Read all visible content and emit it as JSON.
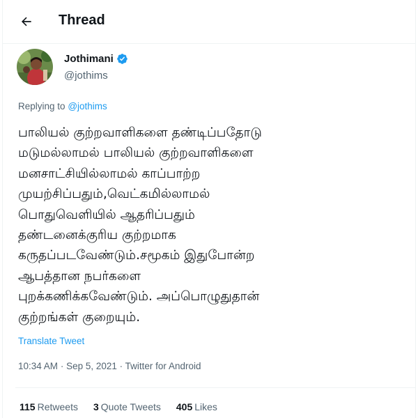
{
  "colors": {
    "accent": "#1d9bf0",
    "secondary_text": "#536471",
    "primary_text": "#0f1419",
    "divider": "#eff3f4"
  },
  "header": {
    "back_icon": "arrow-left-icon",
    "title": "Thread"
  },
  "author": {
    "name": "Jothimani",
    "handle": "@jothims",
    "verified_icon": "verified-badge-icon"
  },
  "tweet": {
    "replying_to_label": "Replying to",
    "replying_to_handle": "@jothims",
    "lines": [
      "பாலியல் குற்றவாளிகளை தண்டிப்பதோடு",
      "மடுமல்லாமல் பாலியல் குற்றவாளிகளை",
      "மனசாட்சியில்லாமல் காப்பாற்ற",
      "முயற்சிப்பதும்,வெட்கமில்லாமல்",
      "பொதுவெளியில் ஆதரிப்பதும்",
      "தண்டனைக்குரிய குற்றமாக",
      "கருதப்படவேண்டும்.சமூகம் இதுபோன்ற",
      "ஆபத்தான நபர்களை",
      "புறக்கணிக்கவேண்டும். அப்பொழுதுதான்",
      "குற்றங்கள் குறையும்."
    ],
    "translate_label": "Translate Tweet",
    "time": "10:34 AM",
    "date": "Sep 5, 2021",
    "source": "Twitter for Android",
    "separator": "·"
  },
  "stats": {
    "retweets_count": "115",
    "retweets_label": "Retweets",
    "quotes_count": "3",
    "quotes_label": "Quote Tweets",
    "likes_count": "405",
    "likes_label": "Likes"
  }
}
